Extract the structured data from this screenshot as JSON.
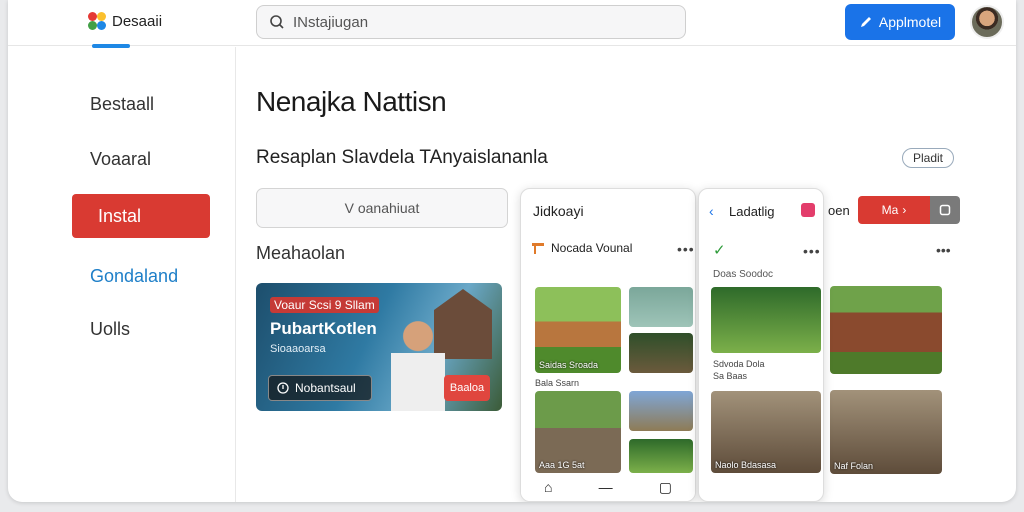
{
  "header": {
    "app_name": "Desaaii",
    "search_value": "INstajiugan",
    "primary_button": "Applmotel",
    "logo_colors": [
      "#e53935",
      "#fbc02d",
      "#43a047",
      "#1e88e5"
    ]
  },
  "sidebar": {
    "items": [
      {
        "label": "Bestaall",
        "state": "normal"
      },
      {
        "label": "Voaaral",
        "state": "normal"
      },
      {
        "label": "Instal",
        "state": "active"
      },
      {
        "label": "Gondaland",
        "state": "link"
      },
      {
        "label": "Uolls",
        "state": "normal"
      }
    ]
  },
  "main": {
    "title": "Nenajka Nattisn",
    "subtitle": "Resaplan  Slavdela TAnyaislananla",
    "chip": "Pladit",
    "filter_label": "V  oanahiuat",
    "section_label": "Meahaolan"
  },
  "feature_card": {
    "badge": "Voaur Scsi 9 Sllam",
    "title": "PubartKotlen",
    "subtitle": "Sioaaoarsa",
    "button": "Nobantsaul",
    "red_tag": "Baaloa"
  },
  "phone_a": {
    "title": "Jidkoayi",
    "row_title": "Nocada Vounal",
    "thumbs": [
      {
        "caption": "Saidas Sroada"
      },
      {
        "caption": ""
      },
      {
        "caption": ""
      },
      {
        "caption": "Bala Ssarn"
      },
      {
        "caption": "Aaa 1G 5at"
      },
      {
        "caption": ""
      },
      {
        "caption": ""
      }
    ],
    "nav": [
      "⌂",
      "—",
      "▢"
    ]
  },
  "phone_b": {
    "title": "Ladatlig",
    "caption_top": "Doas Soodoc",
    "thumbs": [
      {
        "caption": "Sdvoda Dola"
      },
      {
        "caption": "Sa Baas"
      },
      {
        "caption": "Naolo Bdasasa"
      }
    ]
  },
  "right_panel": {
    "label": "oen",
    "red_button": "Ma",
    "thumbs": [
      {
        "caption": ""
      },
      {
        "caption": "Naf Folan"
      }
    ]
  },
  "colors": {
    "accent_blue": "#1a73e8",
    "active_red": "#d93a32",
    "link_blue": "#1e7fc8"
  }
}
